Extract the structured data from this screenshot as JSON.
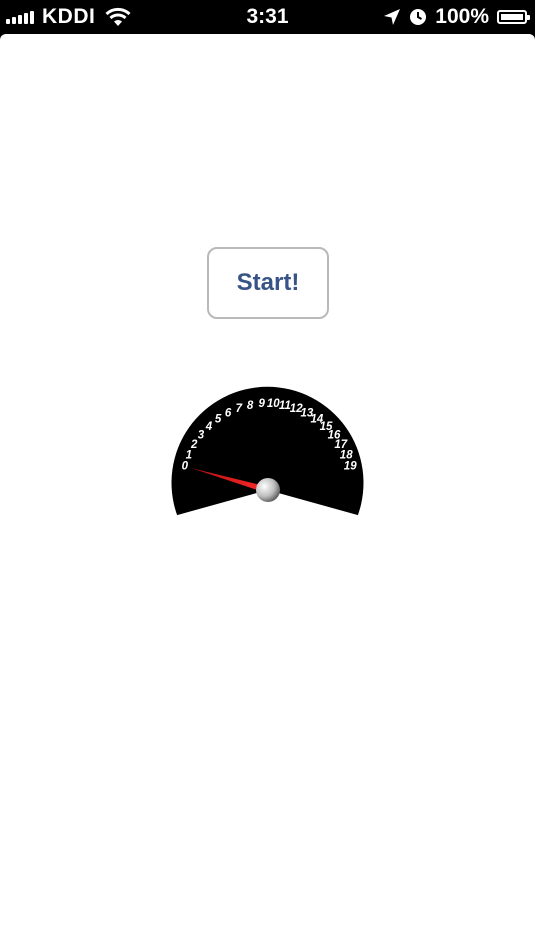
{
  "status_bar": {
    "carrier": "KDDI",
    "time": "3:31",
    "battery_percent": "100%",
    "icons": [
      "signal-bars-icon",
      "wifi-icon",
      "location-arrow-icon",
      "alarm-clock-icon",
      "battery-charging-icon"
    ]
  },
  "main": {
    "start_button_label": "Start!"
  },
  "gauge": {
    "tick_labels": [
      "0",
      "1",
      "2",
      "3",
      "4",
      "5",
      "6",
      "7",
      "8",
      "9",
      "10",
      "11",
      "12",
      "13",
      "14",
      "15",
      "16",
      "17",
      "18",
      "19"
    ],
    "needle_value": 0,
    "colors": {
      "dial": "#000000",
      "needle": "#e02020",
      "labels": "#ffffff"
    }
  }
}
